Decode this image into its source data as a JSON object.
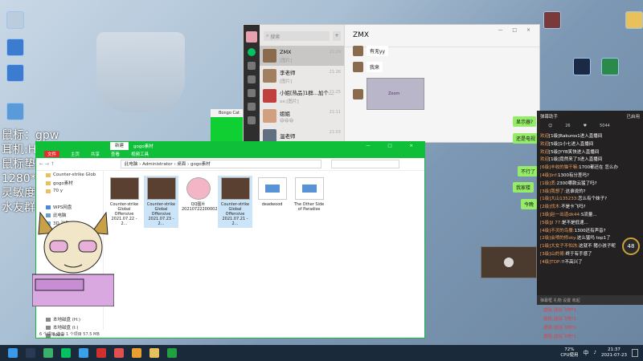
{
  "overlay": {
    "line1": "鼠标：gpw",
    "line2": "耳机:Hyp",
    "line3": "鼠标垫",
    "line4": "1280*9",
    "line5": "灵敏度",
    "line6": "水友群"
  },
  "green_window": {
    "title": "Bongo Cat"
  },
  "wechat": {
    "search_placeholder": "搜索",
    "add_label": "+",
    "chat_title": "ZMX",
    "window_controls": "— □ ×",
    "chats": [
      {
        "name": "ZMX",
        "preview": "[图片]",
        "time": "21:29"
      },
      {
        "name": "李老师",
        "preview": "[图片]",
        "time": "21:26"
      },
      {
        "name": "小姐[热品]1群...加个...",
        "preview": "xx:[图片]",
        "time": "21:25"
      },
      {
        "name": "姐姐",
        "preview": "😄😄😄",
        "time": "21:11"
      },
      {
        "name": "温老师",
        "preview": "",
        "time": "21:03"
      }
    ],
    "messages": [
      {
        "text": "有无yy"
      },
      {
        "text": "我来"
      }
    ],
    "image_caption": "Zoom"
  },
  "green_bubbles": [
    {
      "text": "显示器?"
    },
    {
      "text": "还是电视"
    },
    {
      "text": "不行了"
    },
    {
      "text": "我家楼"
    },
    {
      "text": "今晚"
    }
  ],
  "explorer": {
    "tab_active": "新建",
    "tab_folder": "gogo素材",
    "window_controls": "— □ ×",
    "ribbon": [
      "文件",
      "主页",
      "共享",
      "查看",
      "视频工具"
    ],
    "nav_back": "← → ↑",
    "path": "此电脑 › Administrator › 桌面 › gogo素材",
    "nav_items": [
      "Counter-strike Glob",
      "gogo素材",
      "70 y",
      "",
      "WPS网盘",
      "此电脑",
      "3D 对象",
      "视频",
      "",
      "",
      "",
      "",
      "",
      "",
      "本地磁盘 (H:)",
      "本地磁盘 (I:)",
      "ldww"
    ],
    "files": [
      {
        "name": "Counter-strike Global Offensive 2021.07.22 - 2...",
        "kind": "video"
      },
      {
        "name": "Counter-strike Global Offensive 2021.07.23 - 2...",
        "kind": "video",
        "selected": true
      },
      {
        "name": "QQ图片20210722200002",
        "kind": "kirby"
      },
      {
        "name": "Counter-strike Global Offensive 2021.07.21 - 2...",
        "kind": "video"
      },
      {
        "name": "deadwood",
        "kind": "doc"
      },
      {
        "name": "The Other Side of Paradise",
        "kind": "doc"
      }
    ],
    "status": "6 个项目    选中 1 个项目  57.5 MB"
  },
  "live": {
    "title": "弹幕助手",
    "right_label": "已启用",
    "viewers": "26",
    "likes": "5044",
    "badge": "48",
    "footer": "弹幕框 礼物 设置 收起",
    "messages": [
      {
        "user": "欢迎",
        "text": "[1级]Rakuros1进入直播间"
      },
      {
        "user": "欢迎",
        "text": "[5级]1小七进入直播间"
      },
      {
        "user": "欢迎",
        "text": "[5级]YYB笑快进入直播间"
      },
      {
        "user": "欢迎",
        "text": "[1级]竟然来了3进入直播间"
      },
      {
        "user": "[6级]丰收的猫干嘛:",
        "text": "1700都还在 怎么办"
      },
      {
        "user": "[4级]Inf:",
        "text": "1300有分差吗?"
      },
      {
        "user": "[1级]丢:",
        "text": "2300哪款云猛了吗?"
      },
      {
        "user": "[3级]我想了:",
        "text": "这谁说的?"
      },
      {
        "user": "[1级]大山135233:",
        "text": "怎么有个妹子?"
      },
      {
        "user": "[2级]伐木:",
        "text": "不是卡飞吗?"
      },
      {
        "user": "[3级]赵一出道dk44:",
        "text": "S流量..."
      },
      {
        "user": "[5级]Jl 77:",
        "text": "是不是低速..."
      },
      {
        "user": "[4级]不灵的鸟撒:",
        "text": "1300还有声音?"
      },
      {
        "user": "[2级]会喷的修sky:",
        "text": "这么猛吗 top1了"
      },
      {
        "user": "[1级]大女子不怕冻:",
        "text": "这就不 猪小孩子呢"
      },
      {
        "user": "[3级]山的哥:",
        "text": "终于有手感了"
      },
      {
        "user": "[4级]TOP:",
        "text": "!!不高兴了"
      }
    ],
    "bottom": [
      {
        "user": "虚吼:",
        "text": "送出飞吻*1"
      },
      {
        "user": "虚吼:",
        "text": "送出飞吻*1"
      },
      {
        "user": "虚吼:",
        "text": "送出飞吻*1"
      },
      {
        "user": "虚吼:",
        "text": "送出飞吻*1"
      },
      {
        "user": "虚吼:",
        "text": "送出你就是光照*10"
      }
    ]
  },
  "taskbar": {
    "cpu": "72%",
    "cpu_label": "CPU使用",
    "ime": "中",
    "time": "21:37",
    "date": "2021-07-23",
    "icons": [
      "windows-icon",
      "steam-icon",
      "browser-icon",
      "wechat-icon",
      "qq-icon",
      "netease-icon",
      "media-icon",
      "game-icon",
      "folder-icon",
      "record-icon"
    ]
  }
}
